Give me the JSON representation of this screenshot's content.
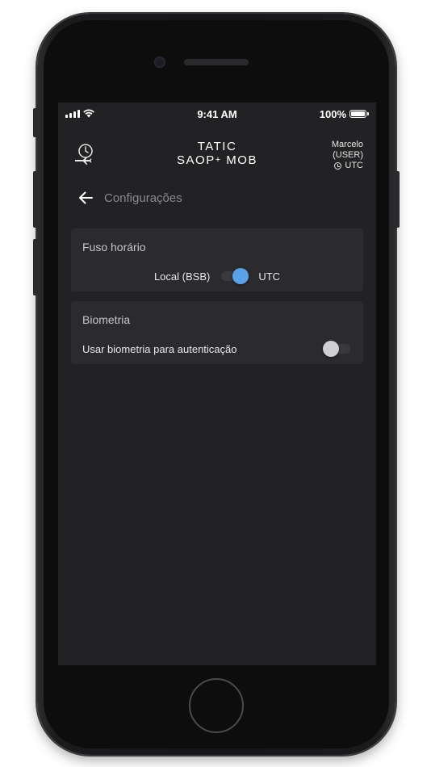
{
  "status_bar": {
    "time": "9:41 AM",
    "battery_percent": "100%",
    "battery_level": 1.0,
    "signal_icon": "cellular-signal-icon",
    "wifi_icon": "wifi-icon"
  },
  "header": {
    "logo_icon": "clock-airplane-logo-icon",
    "brand_line1": "TATIC",
    "brand_line2_main": "SAOP",
    "brand_line2_sup": "+",
    "brand_line2_end": " MOB",
    "user_name": "Marcelo",
    "user_role": "(USER)",
    "timezone": "UTC"
  },
  "page": {
    "back_icon": "arrow-left-icon",
    "title": "Configurações"
  },
  "timezone_card": {
    "title": "Fuso horário",
    "left_label": "Local (BSB)",
    "right_label": "UTC",
    "toggle_on": true
  },
  "biometrics_card": {
    "title": "Biometria",
    "label": "Usar biometria para autenticação",
    "toggle_on": false
  },
  "colors": {
    "accent": "#5aa1e8",
    "screen_bg": "#222224",
    "card_bg": "#2b2b2e"
  }
}
